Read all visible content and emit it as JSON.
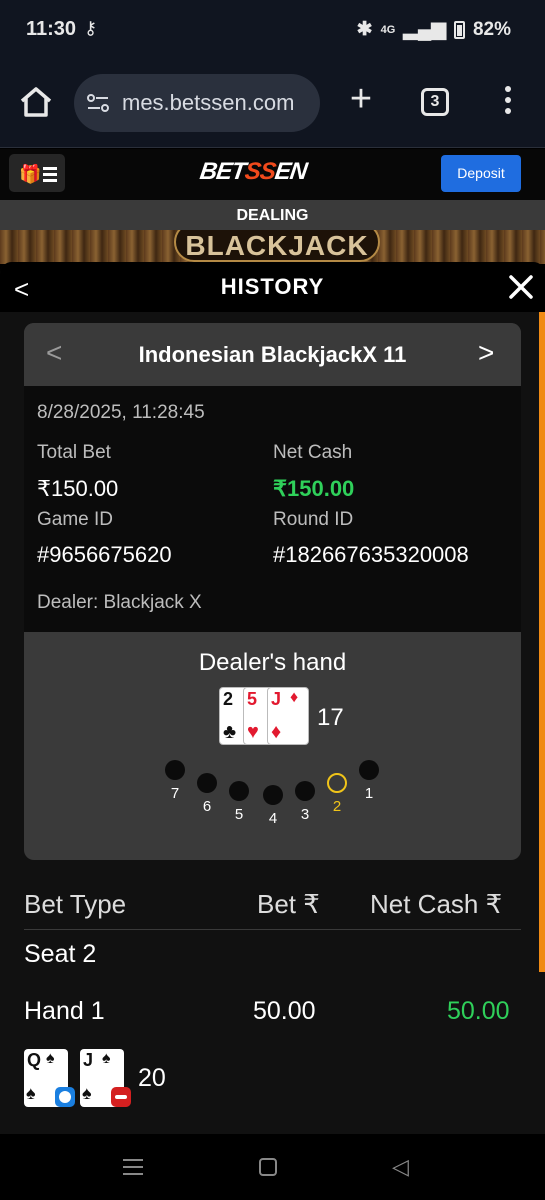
{
  "status_bar": {
    "time": "11:30",
    "battery": "82%",
    "network": "4G"
  },
  "browser": {
    "url": "mes.betssen.com",
    "tab_count": "3"
  },
  "site": {
    "logo_left": "BET",
    "logo_mid": "SS",
    "logo_right": "EN",
    "deposit_label": "Deposit",
    "dealing_label": "DEALING",
    "banner_title": "BLACKJACK"
  },
  "history": {
    "title": "HISTORY",
    "round": {
      "game_title": "Indonesian BlackjackX 11",
      "date": "8/28/2025, 11:28:45",
      "total_bet_label": "Total Bet",
      "total_bet_value": "₹150.00",
      "net_cash_label": "Net Cash",
      "net_cash_value": "₹150.00",
      "game_id_label": "Game ID",
      "game_id_value": "#9656675620",
      "round_id_label": "Round ID",
      "round_id_value": "#182667635320008",
      "dealer": "Dealer: Blackjack X"
    },
    "dealer_hand": {
      "title": "Dealer's hand",
      "total": "17",
      "cards": [
        {
          "rank": "2",
          "suit": "♣",
          "color": "black"
        },
        {
          "rank": "5",
          "suit": "♥",
          "color": "red"
        },
        {
          "rank": "J",
          "suit": "♦",
          "color": "red"
        }
      ]
    },
    "seats": [
      {
        "label": "7",
        "active": false
      },
      {
        "label": "6",
        "active": false
      },
      {
        "label": "5",
        "active": false
      },
      {
        "label": "4",
        "active": false
      },
      {
        "label": "3",
        "active": false
      },
      {
        "label": "2",
        "active": true
      },
      {
        "label": "1",
        "active": false
      }
    ],
    "bet_table": {
      "headers": {
        "bet_type": "Bet Type",
        "bet": "Bet ₹",
        "net_cash": "Net Cash ₹"
      },
      "seat_label": "Seat 2",
      "hands": [
        {
          "label": "Hand 1",
          "bet": "50.00",
          "net_cash": "50.00",
          "total": "20",
          "cards": [
            {
              "rank": "Q",
              "suit": "♠",
              "badge": "split"
            },
            {
              "rank": "J",
              "suit": "♠",
              "badge": "double"
            }
          ]
        }
      ]
    }
  },
  "colors": {
    "accent_green": "#2fd05a",
    "deposit_blue": "#1f6de0",
    "active_seat": "#f0c419",
    "scroll_orange": "#f08a14"
  }
}
